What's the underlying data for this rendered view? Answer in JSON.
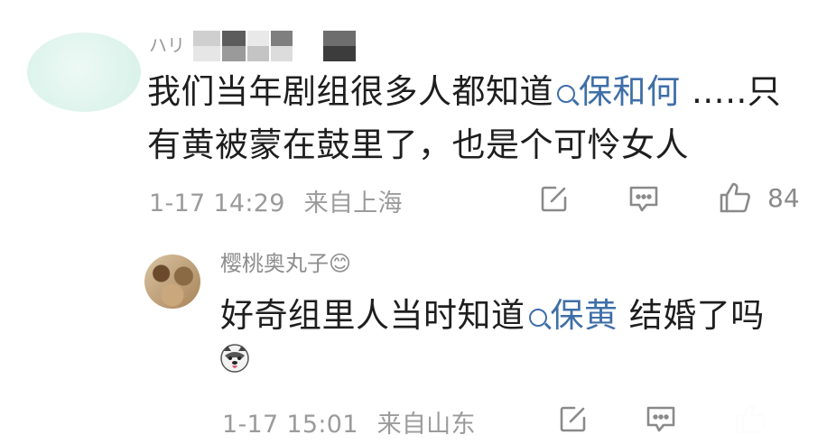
{
  "comment": {
    "username_visible": "ハリ",
    "text_before": "我们当年剧组很多人都知道",
    "mention": "保和何",
    "text_after": " …..只有黄被蒙在鼓里了，也是个可怜女人",
    "timestamp": "1-17 14:29",
    "location": "来自上海",
    "like_count": "84"
  },
  "reply": {
    "username": "樱桃奥丸子😊",
    "text_before": "好奇组里人当时知道",
    "mention": "保黄",
    "text_after": " 结婚了吗",
    "timestamp": "1-17 15:01",
    "location": "来自山东"
  },
  "colors": {
    "mention": "#3f6fa8",
    "meta": "#9b9b9b",
    "text": "#1e1e1e"
  },
  "icons": [
    "share-edit-icon",
    "comment-icon",
    "like-icon",
    "search-mention-icon",
    "husky-emoji-icon"
  ]
}
